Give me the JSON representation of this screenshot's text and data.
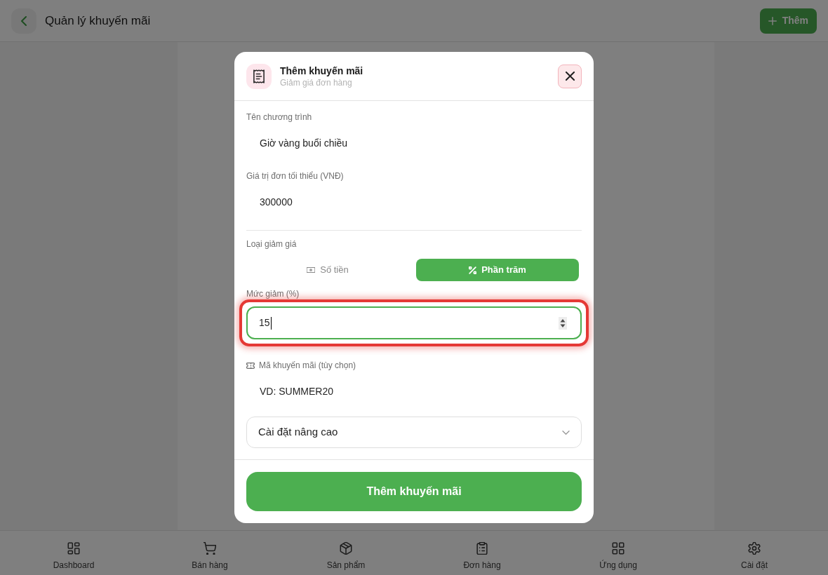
{
  "app_bar": {
    "title": "Quản lý khuyến mãi",
    "add_button": "Thêm"
  },
  "dialog": {
    "title": "Thêm khuyến mãi",
    "subtitle": "Giảm giá đơn hàng",
    "fields": [
      {
        "label": "Tên chương trình",
        "value": "Giờ vàng buổi chiều"
      },
      {
        "label": "Giá trị đơn tối thiểu (VNĐ)",
        "value": "300000"
      }
    ],
    "discount_type": {
      "label": "Loại giảm giá",
      "options": [
        {
          "label": "Số tiền",
          "selected": false
        },
        {
          "label": "Phần trăm",
          "selected": true
        }
      ]
    },
    "discount_value": {
      "label": "Mức giảm (%)",
      "value": "15",
      "focused": true,
      "highlighted": true
    },
    "promo_code": {
      "label": "Mã khuyến mãi (tùy chọn)",
      "placeholder": "VD: SUMMER20"
    },
    "advanced": {
      "label": "Cài đặt nâng cao",
      "expanded": false
    },
    "submit_button": "Thêm khuyến mãi"
  },
  "bottom_nav": [
    {
      "label": "Dashboard"
    },
    {
      "label": "Bán hàng"
    },
    {
      "label": "Sản phẩm"
    },
    {
      "label": "Đơn hàng"
    },
    {
      "label": "Ứng dụng"
    },
    {
      "label": "Cài đặt"
    }
  ]
}
